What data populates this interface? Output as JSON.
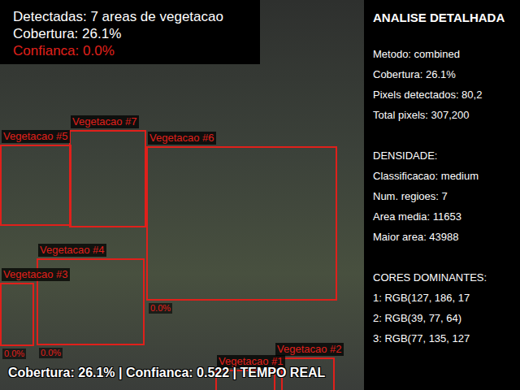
{
  "overlay": {
    "lines": [
      {
        "text": "Detectadas: 7 areas de vegetacao",
        "color": "#ffffff"
      },
      {
        "text": "Cobertura: 26.1%",
        "color": "#ffffff"
      },
      {
        "text": "Confianca: 0.0%",
        "color": "#e0201b"
      }
    ]
  },
  "detections": [
    {
      "label": "Vegetacao #1"
    },
    {
      "label": "Vegetacao #2"
    },
    {
      "label": "Vegetacao #3",
      "score": "0.0%"
    },
    {
      "label": "Vegetacao #4",
      "score": "0.0%"
    },
    {
      "label": "Vegetacao #5"
    },
    {
      "label": "Vegetacao #6",
      "score": "0.0%"
    },
    {
      "label": "Vegetacao #7"
    }
  ],
  "status": "Cobertura: 26.1% | Confianca: 0.522 | TEMPO REAL",
  "panel": {
    "title": "ANALISE DETALHADA",
    "sections": [
      [
        "Metodo: combined",
        "Cobertura: 26.1%",
        "Pixels detectados: 80,2",
        "Total pixels: 307,200"
      ],
      [
        "DENSIDADE:",
        "Classificacao: medium",
        "Num. regioes: 7",
        "Area media: 11653",
        "Maior area: 43988"
      ],
      [
        "CORES DOMINANTES:",
        "1: RGB(127, 186, 17",
        "2: RGB(39, 77, 64)",
        "3: RGB(77, 135, 127"
      ]
    ]
  }
}
